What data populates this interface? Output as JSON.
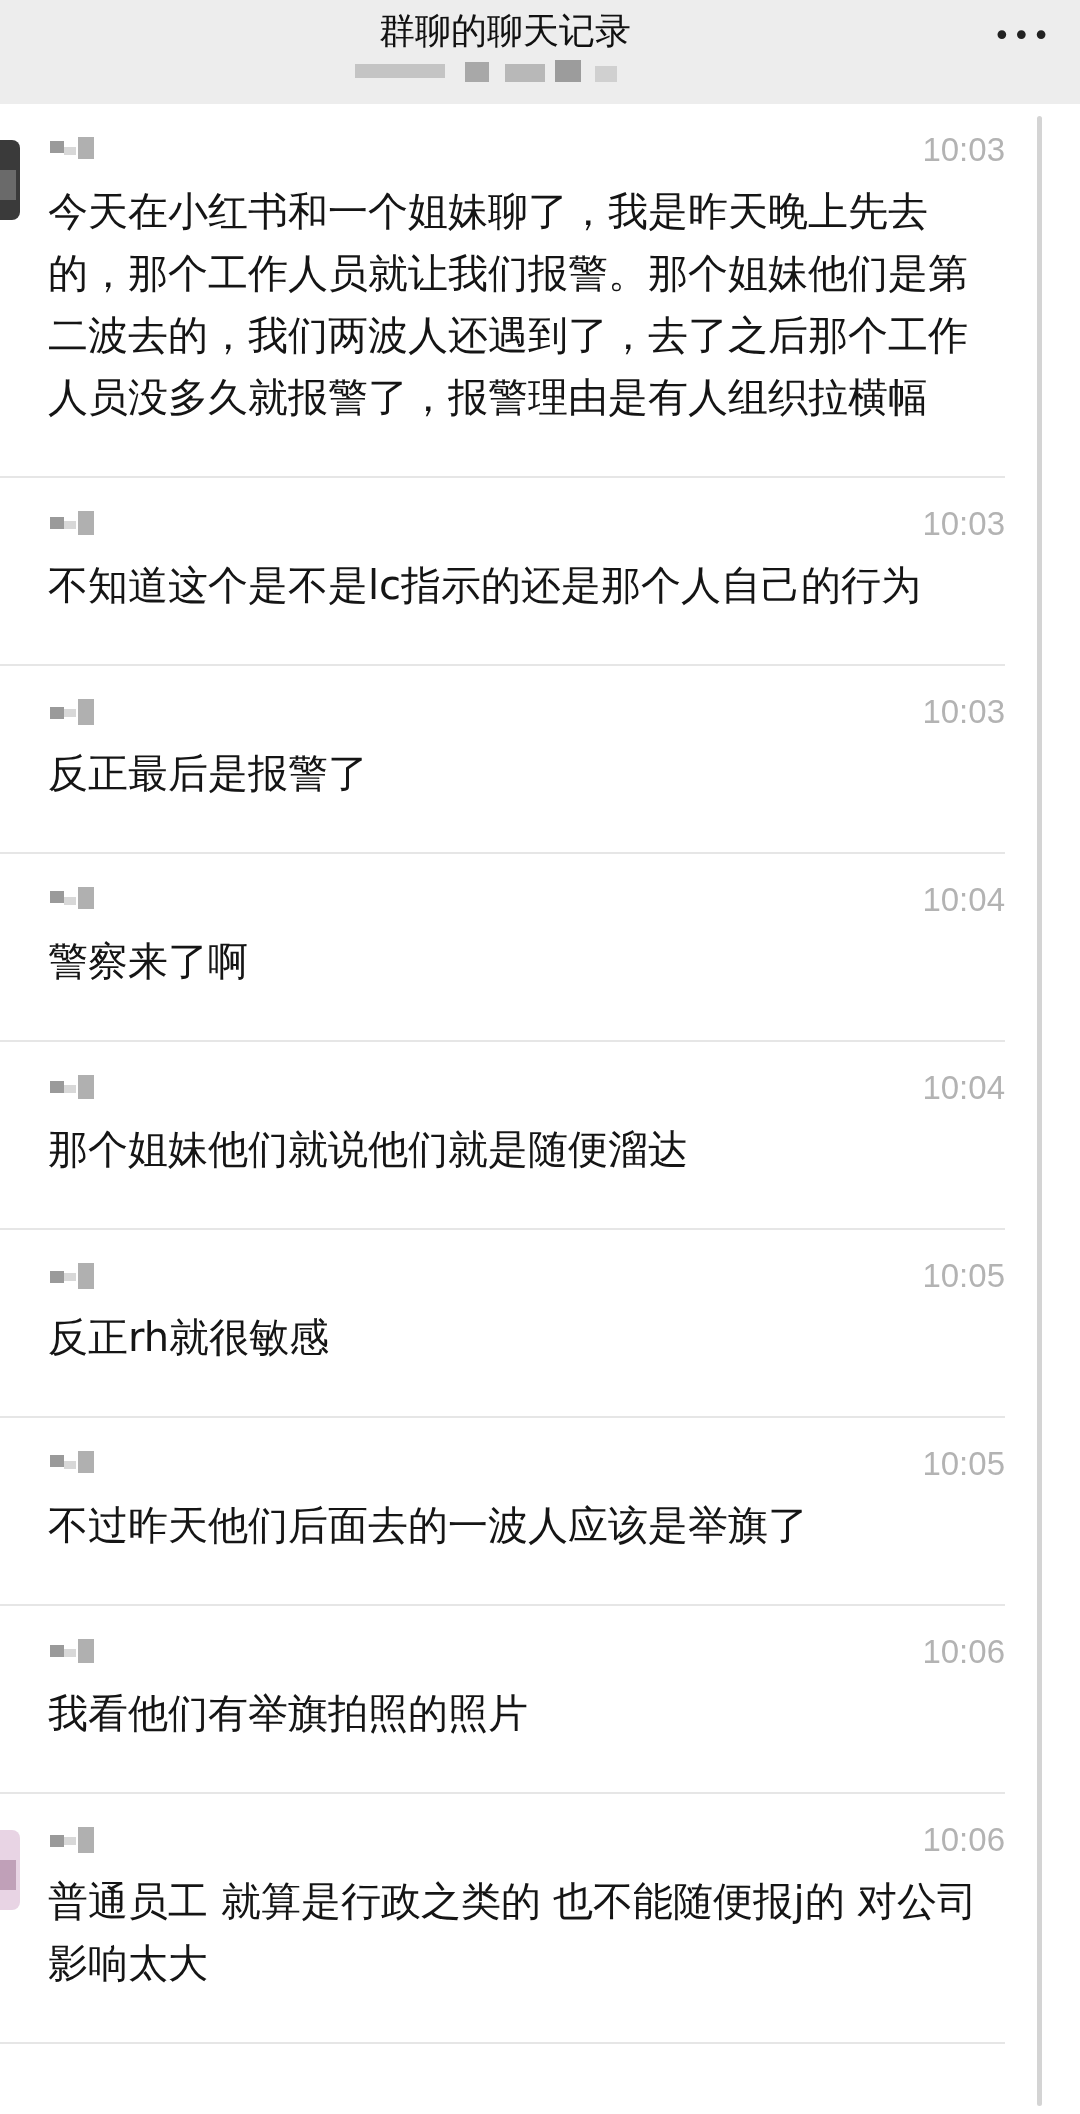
{
  "header": {
    "title": "群聊的聊天记录",
    "more_icon": "•••"
  },
  "messages": [
    {
      "avatar": true,
      "time": "10:03",
      "text": "今天在小红书和一个姐妹聊了，我是昨天晚上先去的，那个工作人员就让我们报警。那个姐妹他们是第二波去的，我们两波人还遇到了，去了之后那个工作人员没多久就报警了，报警理由是有人组织拉横幅"
    },
    {
      "avatar": false,
      "time": "10:03",
      "text": "不知道这个是不是lc指示的还是那个人自己的行为"
    },
    {
      "avatar": false,
      "time": "10:03",
      "text": "反正最后是报警了"
    },
    {
      "avatar": false,
      "time": "10:04",
      "text": "警察来了啊"
    },
    {
      "avatar": false,
      "time": "10:04",
      "text": "那个姐妹他们就说他们就是随便溜达"
    },
    {
      "avatar": false,
      "time": "10:05",
      "text": "反正rh就很敏感"
    },
    {
      "avatar": false,
      "time": "10:05",
      "text": "不过昨天他们后面去的一波人应该是举旗了"
    },
    {
      "avatar": false,
      "time": "10:06",
      "text": "我看他们有举旗拍照的照片"
    },
    {
      "avatar": true,
      "time": "10:06",
      "text": "普通员工 就算是行政之类的 也不能随便报j的 对公司影响太大"
    }
  ]
}
